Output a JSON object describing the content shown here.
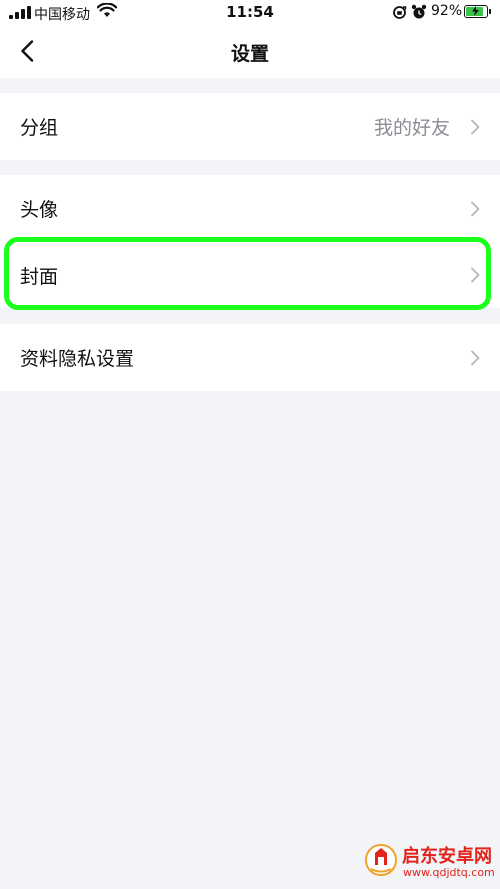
{
  "status_bar": {
    "carrier": "中国移动",
    "time": "11:54",
    "battery_percent": "92%",
    "battery_level": 0.92
  },
  "nav": {
    "title": "设置",
    "back_icon": "chevron-left-icon"
  },
  "rows": {
    "group": {
      "label": "分组",
      "value": "我的好友"
    },
    "avatar": {
      "label": "头像"
    },
    "cover": {
      "label": "封面"
    },
    "privacy": {
      "label": "资料隐私设置"
    }
  },
  "highlight_color": "#1cff1c",
  "watermark": {
    "title": "启东安卓网",
    "url": "www.qdjdtq.com"
  }
}
